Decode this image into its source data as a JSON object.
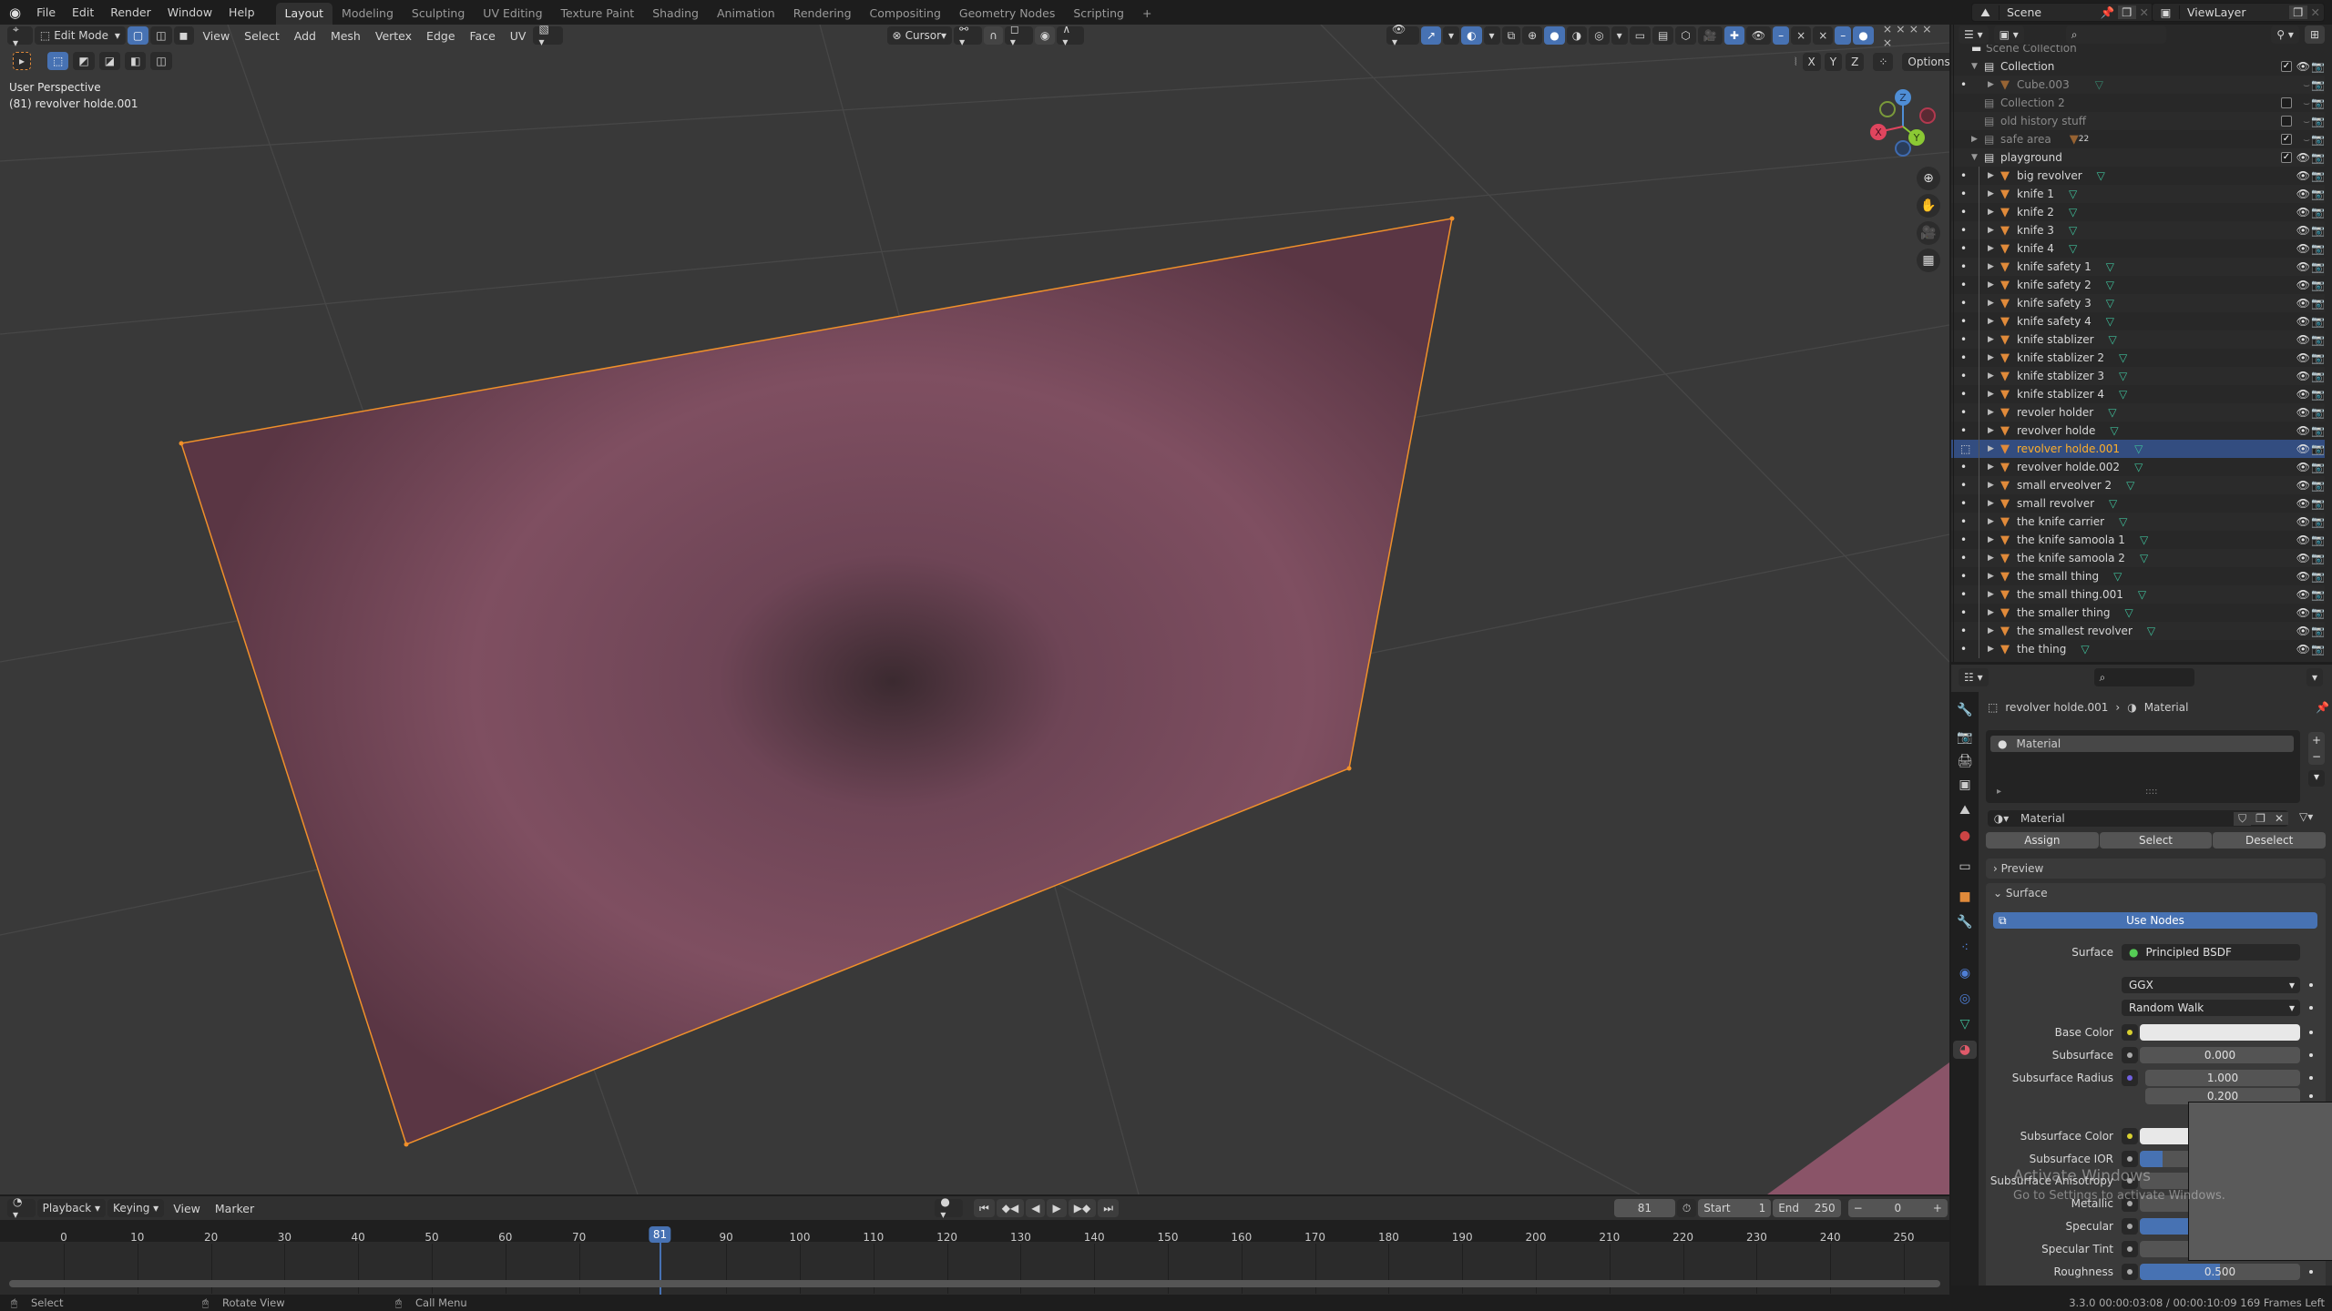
{
  "topbar": {
    "menus": [
      "File",
      "Edit",
      "Render",
      "Window",
      "Help"
    ],
    "workspaces": [
      "Layout",
      "Modeling",
      "Sculpting",
      "UV Editing",
      "Texture Paint",
      "Shading",
      "Animation",
      "Rendering",
      "Compositing",
      "Geometry Nodes",
      "Scripting"
    ],
    "active_workspace": "Layout",
    "add_tab": "+",
    "scene": "Scene",
    "view_layer": "ViewLayer"
  },
  "viewport": {
    "mode": "Edit Mode",
    "menus": [
      "View",
      "Select",
      "Add",
      "Mesh",
      "Vertex",
      "Edge",
      "Face",
      "UV"
    ],
    "transform_pivot": "Cursor",
    "view_name": "User Perspective",
    "object_info": "(81) revolver holde.001",
    "options_label": "Options",
    "mirror_axes": [
      "X",
      "Y",
      "Z"
    ],
    "gizmo_axes": {
      "x": "X",
      "y": "Y",
      "z": "Z"
    },
    "colors": {
      "plane": "#8a5468",
      "edge": "#f0902a",
      "background": "#393939",
      "grid": "#474747"
    }
  },
  "outliner": {
    "search_placeholder": "",
    "scene_collection": "Scene Collection",
    "collections": [
      {
        "name": "Collection",
        "expanded": true,
        "checked": true,
        "visible": true
      },
      {
        "name": "Cube.003",
        "type": "object",
        "dim": true
      },
      {
        "name": "Collection 2",
        "checked": false,
        "dim": true
      },
      {
        "name": "old history stuff",
        "checked": false,
        "dim": true
      },
      {
        "name": "safe area",
        "checked": true,
        "dim": true,
        "badge": "22"
      },
      {
        "name": "playground",
        "expanded": true,
        "checked": true,
        "visible": true
      }
    ],
    "objects": [
      "big revolver",
      "knife 1",
      "knife 2",
      "knife 3",
      "knife 4",
      "knife safety 1",
      "knife safety 2",
      "knife safety 3",
      "knife safety 4",
      "knife stablizer",
      "knife stablizer 2",
      "knife stablizer 3",
      "knife stablizer 4",
      "revoler holder",
      "revolver holde",
      "revolver holde.001",
      "revolver holde.002",
      "small erveolver 2",
      "small revolver",
      "the knife carrier",
      "the knife samoola 1",
      "the knife samoola 2",
      "the small thing",
      "the small thing.001",
      "the smaller thing",
      "the smallest revolver",
      "the thing"
    ],
    "selected": "revolver holde.001"
  },
  "properties": {
    "breadcrumb_object": "revolver holde.001",
    "breadcrumb_tab": "Material",
    "slot_name": "Material",
    "material_name": "Material",
    "buttons": {
      "assign": "Assign",
      "select": "Select",
      "deselect": "Deselect"
    },
    "panels": {
      "preview": "Preview",
      "surface": "Surface"
    },
    "use_nodes": "Use Nodes",
    "surface_label": "Surface",
    "surface_value": "Principled BSDF",
    "distribution": "GGX",
    "subsurface_method": "Random Walk",
    "fields": [
      {
        "label": "Base Color",
        "type": "color",
        "value": "#e8e8e8"
      },
      {
        "label": "Subsurface",
        "value": "0.000"
      },
      {
        "label": "Subsurface Radius",
        "value": "1.000"
      },
      {
        "label": "",
        "value": "0.200"
      },
      {
        "label": "Subsurface Color",
        "type": "color",
        "value": "#e8e8e8"
      },
      {
        "label": "Subsurface IOR",
        "fill": 0.14
      },
      {
        "label": "Subsurface Anisotropy"
      },
      {
        "label": "Metallic"
      },
      {
        "label": "Specular",
        "fill": 0.5
      },
      {
        "label": "Specular Tint"
      },
      {
        "label": "Roughness",
        "value": "0.500",
        "fill": 0.5
      }
    ]
  },
  "timeline": {
    "menus": [
      "Playback",
      "Keying",
      "View",
      "Marker"
    ],
    "current_frame": "81",
    "start_label": "Start",
    "start": "1",
    "end_label": "End",
    "end": "250",
    "offset": "0",
    "ticks": [
      "0",
      "10",
      "20",
      "30",
      "40",
      "50",
      "60",
      "70",
      "81",
      "90",
      "100",
      "110",
      "120",
      "130",
      "140",
      "150",
      "160",
      "170",
      "180",
      "190",
      "200",
      "210",
      "220",
      "230",
      "240",
      "250"
    ]
  },
  "statusbar": {
    "select": "Select",
    "rotate": "Rotate View",
    "call_menu": "Call Menu",
    "info": "3.3.0  00:00:03:08 / 00:00:10:09  169 Frames Left"
  },
  "watermark": {
    "line1": "Activate Windows",
    "line2": "Go to Settings to activate Windows."
  }
}
